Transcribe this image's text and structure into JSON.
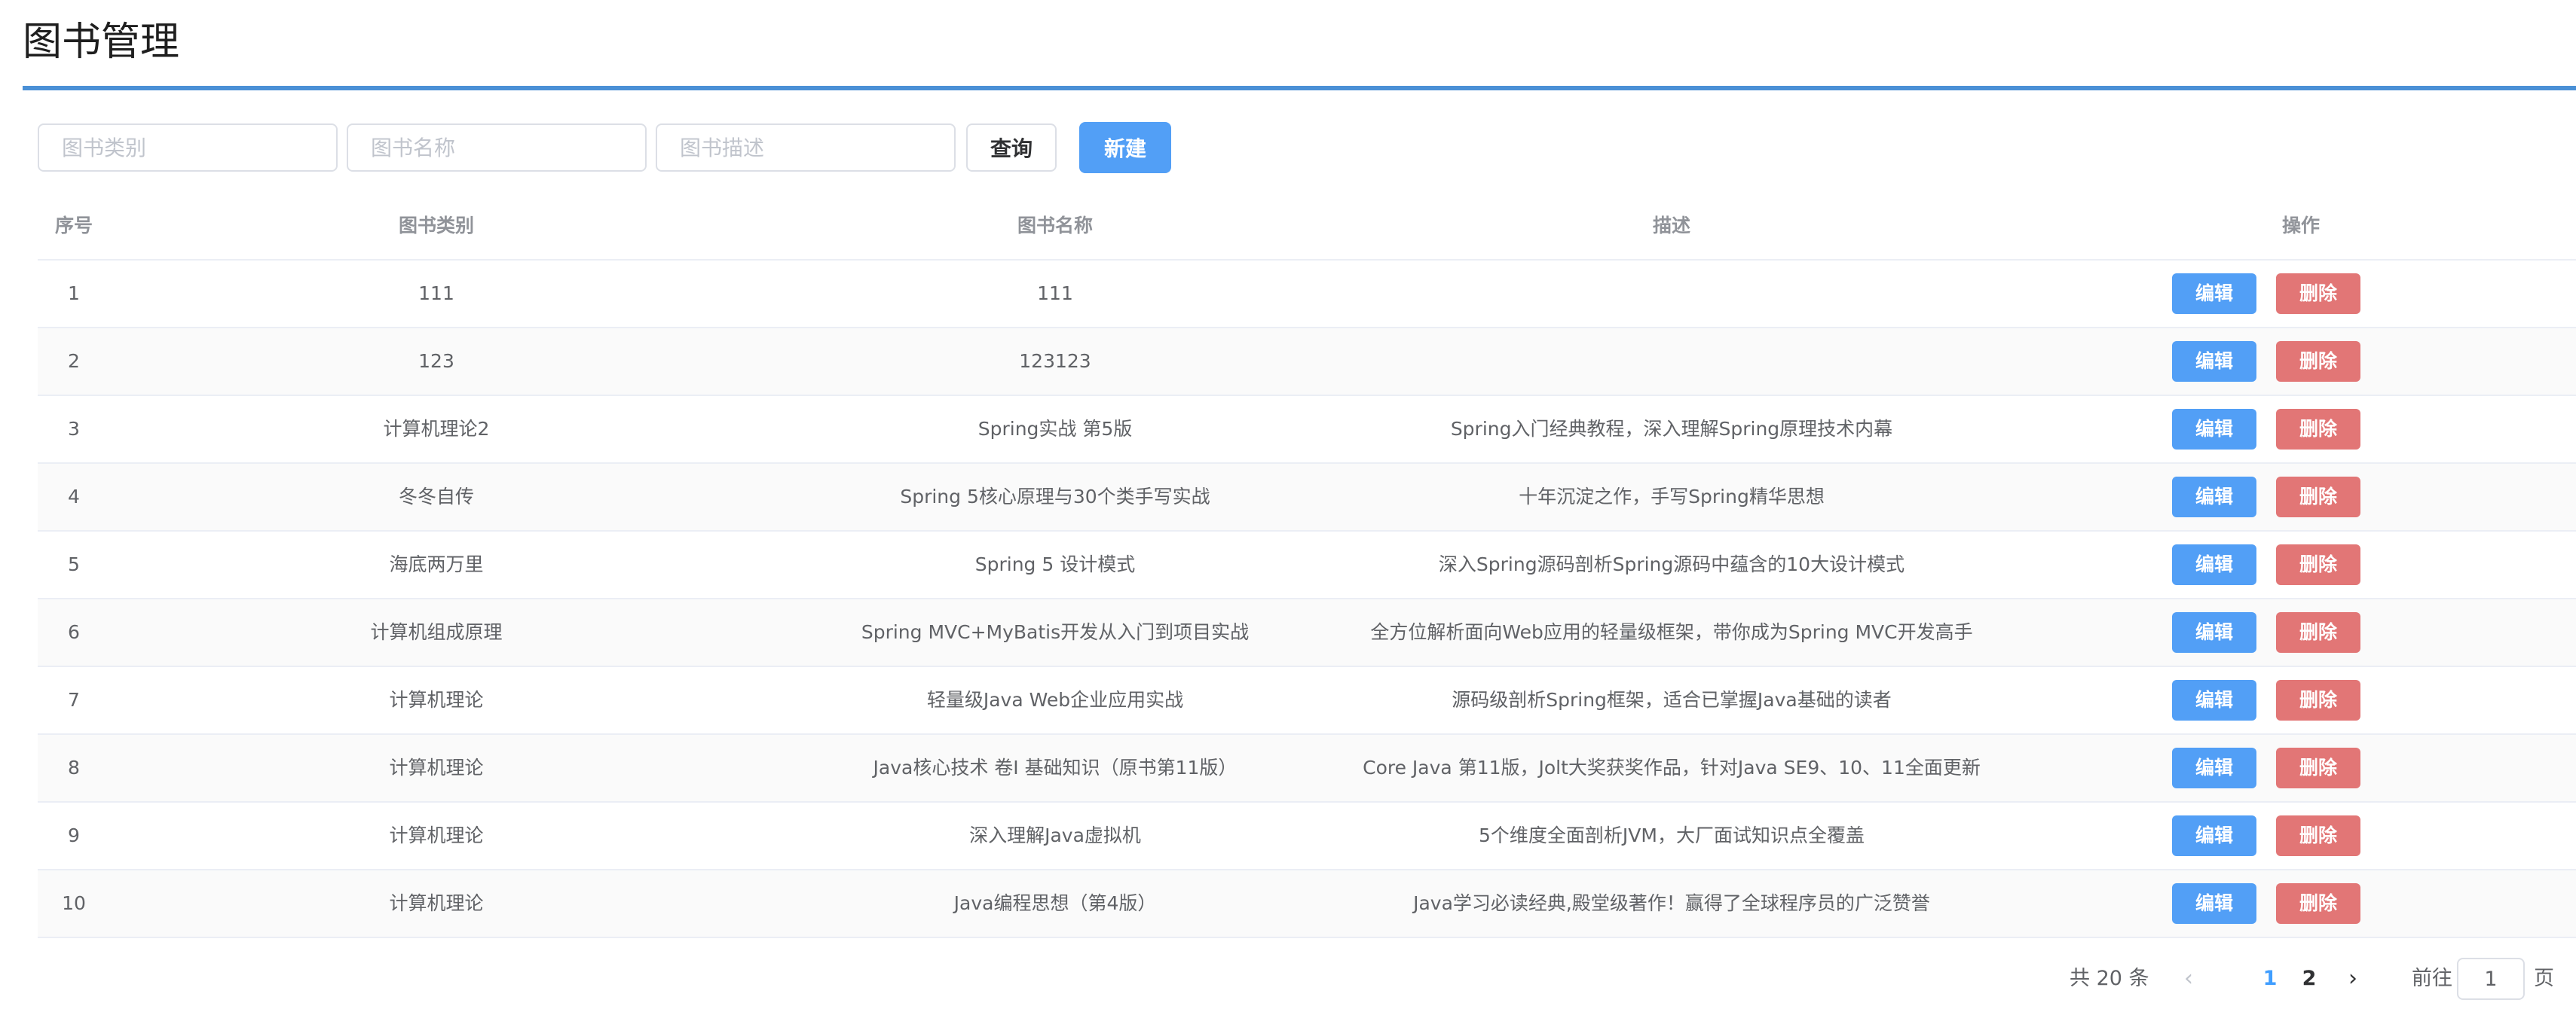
{
  "page": {
    "title": "图书管理"
  },
  "search": {
    "category_placeholder": "图书类别",
    "name_placeholder": "图书名称",
    "desc_placeholder": "图书描述",
    "query_label": "查询",
    "new_label": "新建"
  },
  "table": {
    "headers": {
      "index": "序号",
      "category": "图书类别",
      "name": "图书名称",
      "description": "描述",
      "actions": "操作"
    },
    "edit_label": "编辑",
    "delete_label": "删除",
    "rows": [
      {
        "index": "1",
        "category": "111",
        "name": "111",
        "description": ""
      },
      {
        "index": "2",
        "category": "123",
        "name": "123123",
        "description": ""
      },
      {
        "index": "3",
        "category": "计算机理论2",
        "name": "Spring实战 第5版",
        "description": "Spring入门经典教程，深入理解Spring原理技术内幕"
      },
      {
        "index": "4",
        "category": "冬冬自传",
        "name": "Spring 5核心原理与30个类手写实战",
        "description": "十年沉淀之作，手写Spring精华思想"
      },
      {
        "index": "5",
        "category": "海底两万里",
        "name": "Spring 5 设计模式",
        "description": "深入Spring源码剖析Spring源码中蕴含的10大设计模式"
      },
      {
        "index": "6",
        "category": "计算机组成原理",
        "name": "Spring MVC+MyBatis开发从入门到项目实战",
        "description": "全方位解析面向Web应用的轻量级框架，带你成为Spring MVC开发高手"
      },
      {
        "index": "7",
        "category": "计算机理论",
        "name": "轻量级Java Web企业应用实战",
        "description": "源码级剖析Spring框架，适合已掌握Java基础的读者"
      },
      {
        "index": "8",
        "category": "计算机理论",
        "name": "Java核心技术 卷I 基础知识（原书第11版）",
        "description": "Core Java 第11版，Jolt大奖获奖作品，针对Java SE9、10、11全面更新"
      },
      {
        "index": "9",
        "category": "计算机理论",
        "name": "深入理解Java虚拟机",
        "description": "5个维度全面剖析JVM，大厂面试知识点全覆盖"
      },
      {
        "index": "10",
        "category": "计算机理论",
        "name": "Java编程思想（第4版）",
        "description": "Java学习必读经典,殿堂级著作！赢得了全球程序员的广泛赞誉"
      }
    ]
  },
  "pagination": {
    "total_text": "共 20 条",
    "prev_icon": "chevron-left-icon",
    "pages": [
      "1",
      "2"
    ],
    "current_page": "1",
    "next_icon": "chevron-right-icon",
    "goto_label": "前往",
    "goto_value": "1",
    "page_suffix": "页"
  },
  "colors": {
    "primary": "#529ff6",
    "danger": "#e27676",
    "divider": "#4a90d6"
  }
}
